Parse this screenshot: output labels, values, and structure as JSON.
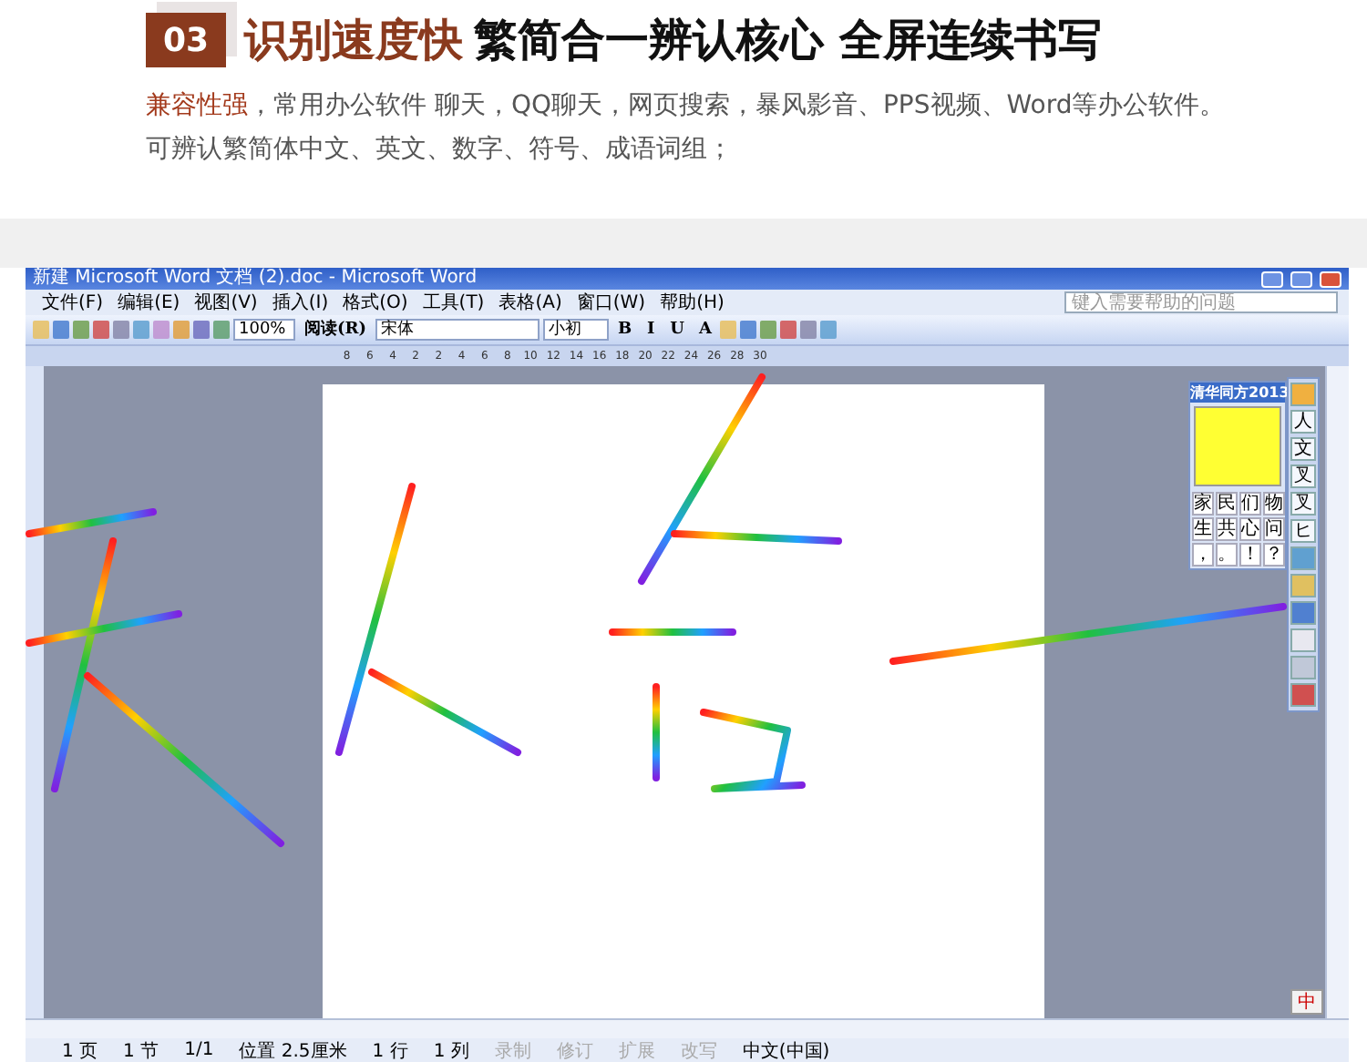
{
  "header": {
    "badge": "03",
    "title_highlight": "识别速度快",
    "title_rest": "繁简合一辨认核心 全屏连续书写",
    "description_highlight": "兼容性强",
    "description_rest": "，常用办公软件 聊天，QQ聊天，网页搜索，暴风影音、PPS视频、Word等办公软件。可辨认繁简体中文、英文、数字、符号、成语词组；"
  },
  "window": {
    "title": "新建 Microsoft Word 文档 (2).doc - Microsoft Word",
    "menu": [
      "文件(F)",
      "编辑(E)",
      "视图(V)",
      "插入(I)",
      "格式(O)",
      "工具(T)",
      "表格(A)",
      "窗口(W)",
      "帮助(H)"
    ],
    "help_placeholder": "键入需要帮助的问题",
    "toolbar": {
      "zoom": "100%",
      "read": "阅读(R)",
      "font": "宋体",
      "size": "小初",
      "format_buttons": [
        "B",
        "I",
        "U",
        "A"
      ]
    },
    "ruler": [
      "8",
      "6",
      "4",
      "2",
      "2",
      "4",
      "6",
      "8",
      "10",
      "12",
      "14",
      "16",
      "18",
      "20",
      "22",
      "24",
      "26",
      "28",
      "30"
    ],
    "input_panel": {
      "title": "清华同方2013",
      "candidates": [
        "家",
        "民",
        "们",
        "物",
        "生",
        "共",
        "心",
        "问",
        "，",
        "。",
        "！",
        "？"
      ],
      "side_tools": [
        "人",
        "文",
        "叉",
        "叉",
        "ヒ"
      ]
    },
    "status_bar": [
      {
        "text": "1 页",
        "disabled": false
      },
      {
        "text": "1 节",
        "disabled": false
      },
      {
        "text": "1/1",
        "disabled": false
      },
      {
        "text": "位置 2.5厘米",
        "disabled": false
      },
      {
        "text": "1 行",
        "disabled": false
      },
      {
        "text": "1 列",
        "disabled": false
      },
      {
        "text": "录制",
        "disabled": true
      },
      {
        "text": "修订",
        "disabled": true
      },
      {
        "text": "扩展",
        "disabled": true
      },
      {
        "text": "改写",
        "disabled": true
      },
      {
        "text": "中文(中国)",
        "disabled": false
      }
    ],
    "ime_bar": "中"
  }
}
